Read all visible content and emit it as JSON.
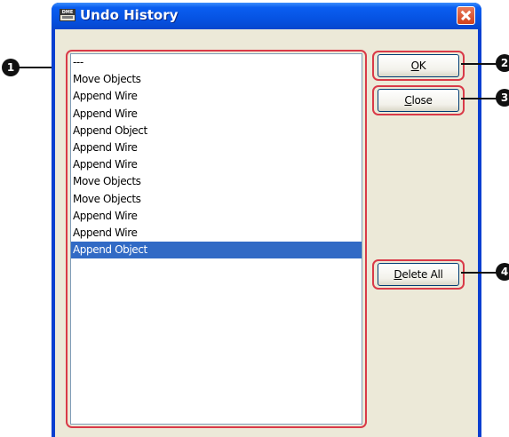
{
  "window": {
    "title": "Undo History",
    "icon_label": "DME"
  },
  "history": {
    "items": [
      "---",
      "Move Objects",
      "Append Wire",
      "Append Wire",
      "Append Object",
      "Append Wire",
      "Append Wire",
      "Move Objects",
      "Move Objects",
      "Append Wire",
      "Append Wire",
      "Append Object"
    ],
    "selected_index": 11
  },
  "buttons": {
    "ok": {
      "mnemonic": "O",
      "rest": "K"
    },
    "close": {
      "mnemonic": "C",
      "rest": "lose"
    },
    "delete_all": {
      "mnemonic": "D",
      "rest": "elete All"
    }
  },
  "callouts": [
    "1",
    "2",
    "3",
    "4"
  ],
  "colors": {
    "highlight_outline": "#d93a48",
    "selection": "#316ac5",
    "titlebar": "#0653e3"
  }
}
